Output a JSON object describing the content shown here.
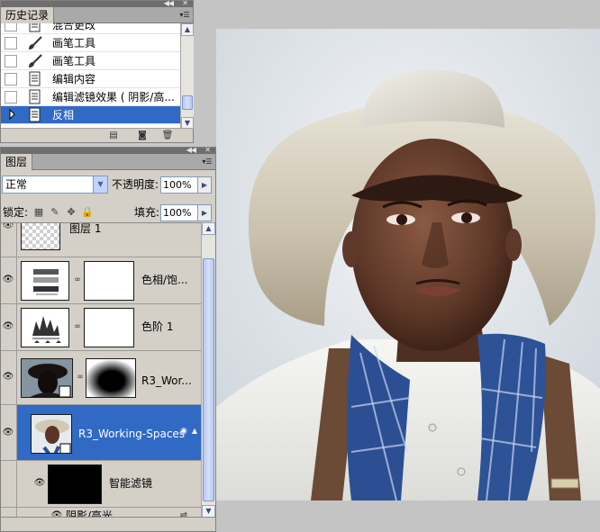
{
  "history_panel": {
    "tab_label": "历史记录",
    "items": [
      {
        "label": "混合更改",
        "selected": false
      },
      {
        "label": "画笔工具",
        "selected": false,
        "icon": "brush-icon"
      },
      {
        "label": "画笔工具",
        "selected": false,
        "icon": "brush-icon"
      },
      {
        "label": "编辑内容",
        "selected": false,
        "icon": "document-icon"
      },
      {
        "label": "编辑滤镜效果 ( 阴影/高...",
        "selected": false,
        "icon": "document-icon"
      },
      {
        "label": "反相",
        "selected": true,
        "icon": "document-icon"
      }
    ],
    "footer_icons": [
      "new-document-from-state-icon",
      "snapshot-icon",
      "trash-icon"
    ]
  },
  "layers_panel": {
    "tab_label": "图层",
    "blend_mode": "正常",
    "opacity_label": "不透明度:",
    "opacity_value": "100%",
    "lock_label": "锁定:",
    "fill_label": "填充:",
    "fill_value": "100%",
    "layers": [
      {
        "name": "图层 1",
        "visible": true,
        "type": "pixel"
      },
      {
        "name": "色相/饱...",
        "visible": true,
        "type": "adjustment-hue-saturation"
      },
      {
        "name": "色阶 1",
        "visible": true,
        "type": "adjustment-levels"
      },
      {
        "name": "R3_Wor...",
        "visible": true,
        "type": "smart-object-masked"
      },
      {
        "name": "R3_Working-Spaces",
        "visible": true,
        "type": "smart-object",
        "selected": true
      }
    ],
    "smart_filters_label": "智能滤镜",
    "filter_item_label": "阴影/高光"
  },
  "colors": {
    "selection": "#316ac5",
    "panel_bg": "#d4d0c8",
    "canvas_bg": "#c4c4c4"
  }
}
